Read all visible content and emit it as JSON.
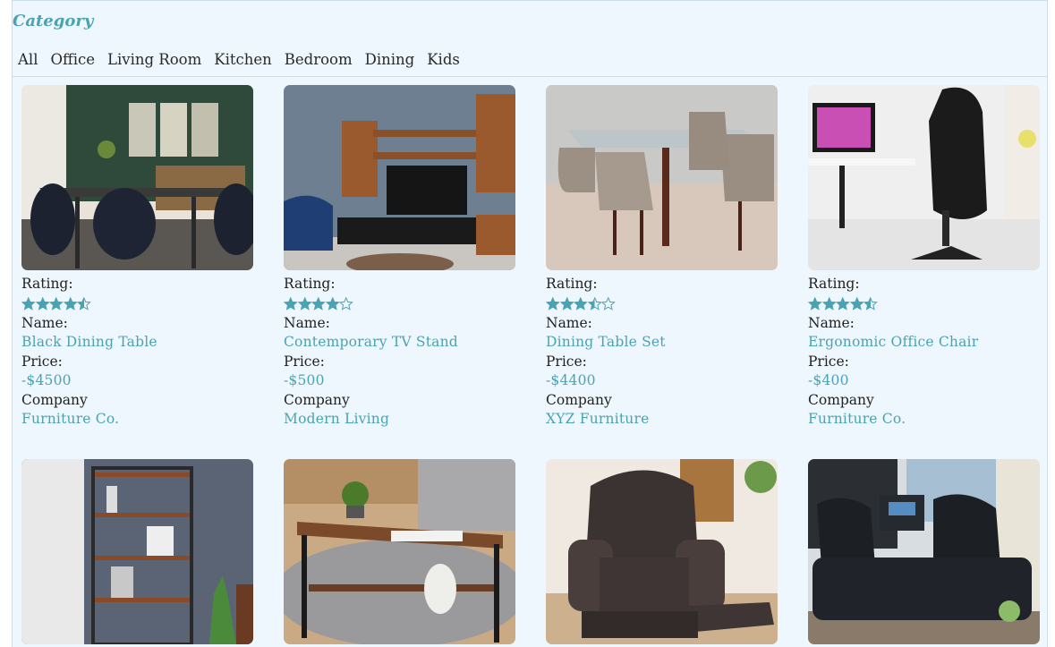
{
  "header": {
    "category_title": "Category",
    "filters": [
      "All",
      "Office",
      "Living Room",
      "Kitchen",
      "Bedroom",
      "Dining",
      "Kids"
    ]
  },
  "labels": {
    "rating": "Rating:",
    "name": "Name:",
    "price": "Price:",
    "company": "Company"
  },
  "colors": {
    "accent": "#4aa3b3",
    "background": "#eef7fd",
    "text": "#222222"
  },
  "products": [
    {
      "name": "Black Dining Table",
      "price": "-$4500",
      "company": "Furniture Co.",
      "rating": 4.5,
      "image": "dining-room-photo"
    },
    {
      "name": "Contemporary TV Stand",
      "price": "-$500",
      "company": "Modern Living",
      "rating": 4,
      "image": "tv-stand-photo"
    },
    {
      "name": "Dining Table Set",
      "price": "-$4400",
      "company": "XYZ Furniture",
      "rating": 3.5,
      "image": "glass-dining-set-photo"
    },
    {
      "name": "Ergonomic Office Chair",
      "price": "-$400",
      "company": "Furniture Co.",
      "rating": 4.5,
      "image": "office-chair-photo"
    },
    {
      "image": "bookshelf-photo"
    },
    {
      "image": "coffee-table-photo"
    },
    {
      "image": "recliner-photo"
    },
    {
      "image": "leather-sofa-photo"
    }
  ]
}
